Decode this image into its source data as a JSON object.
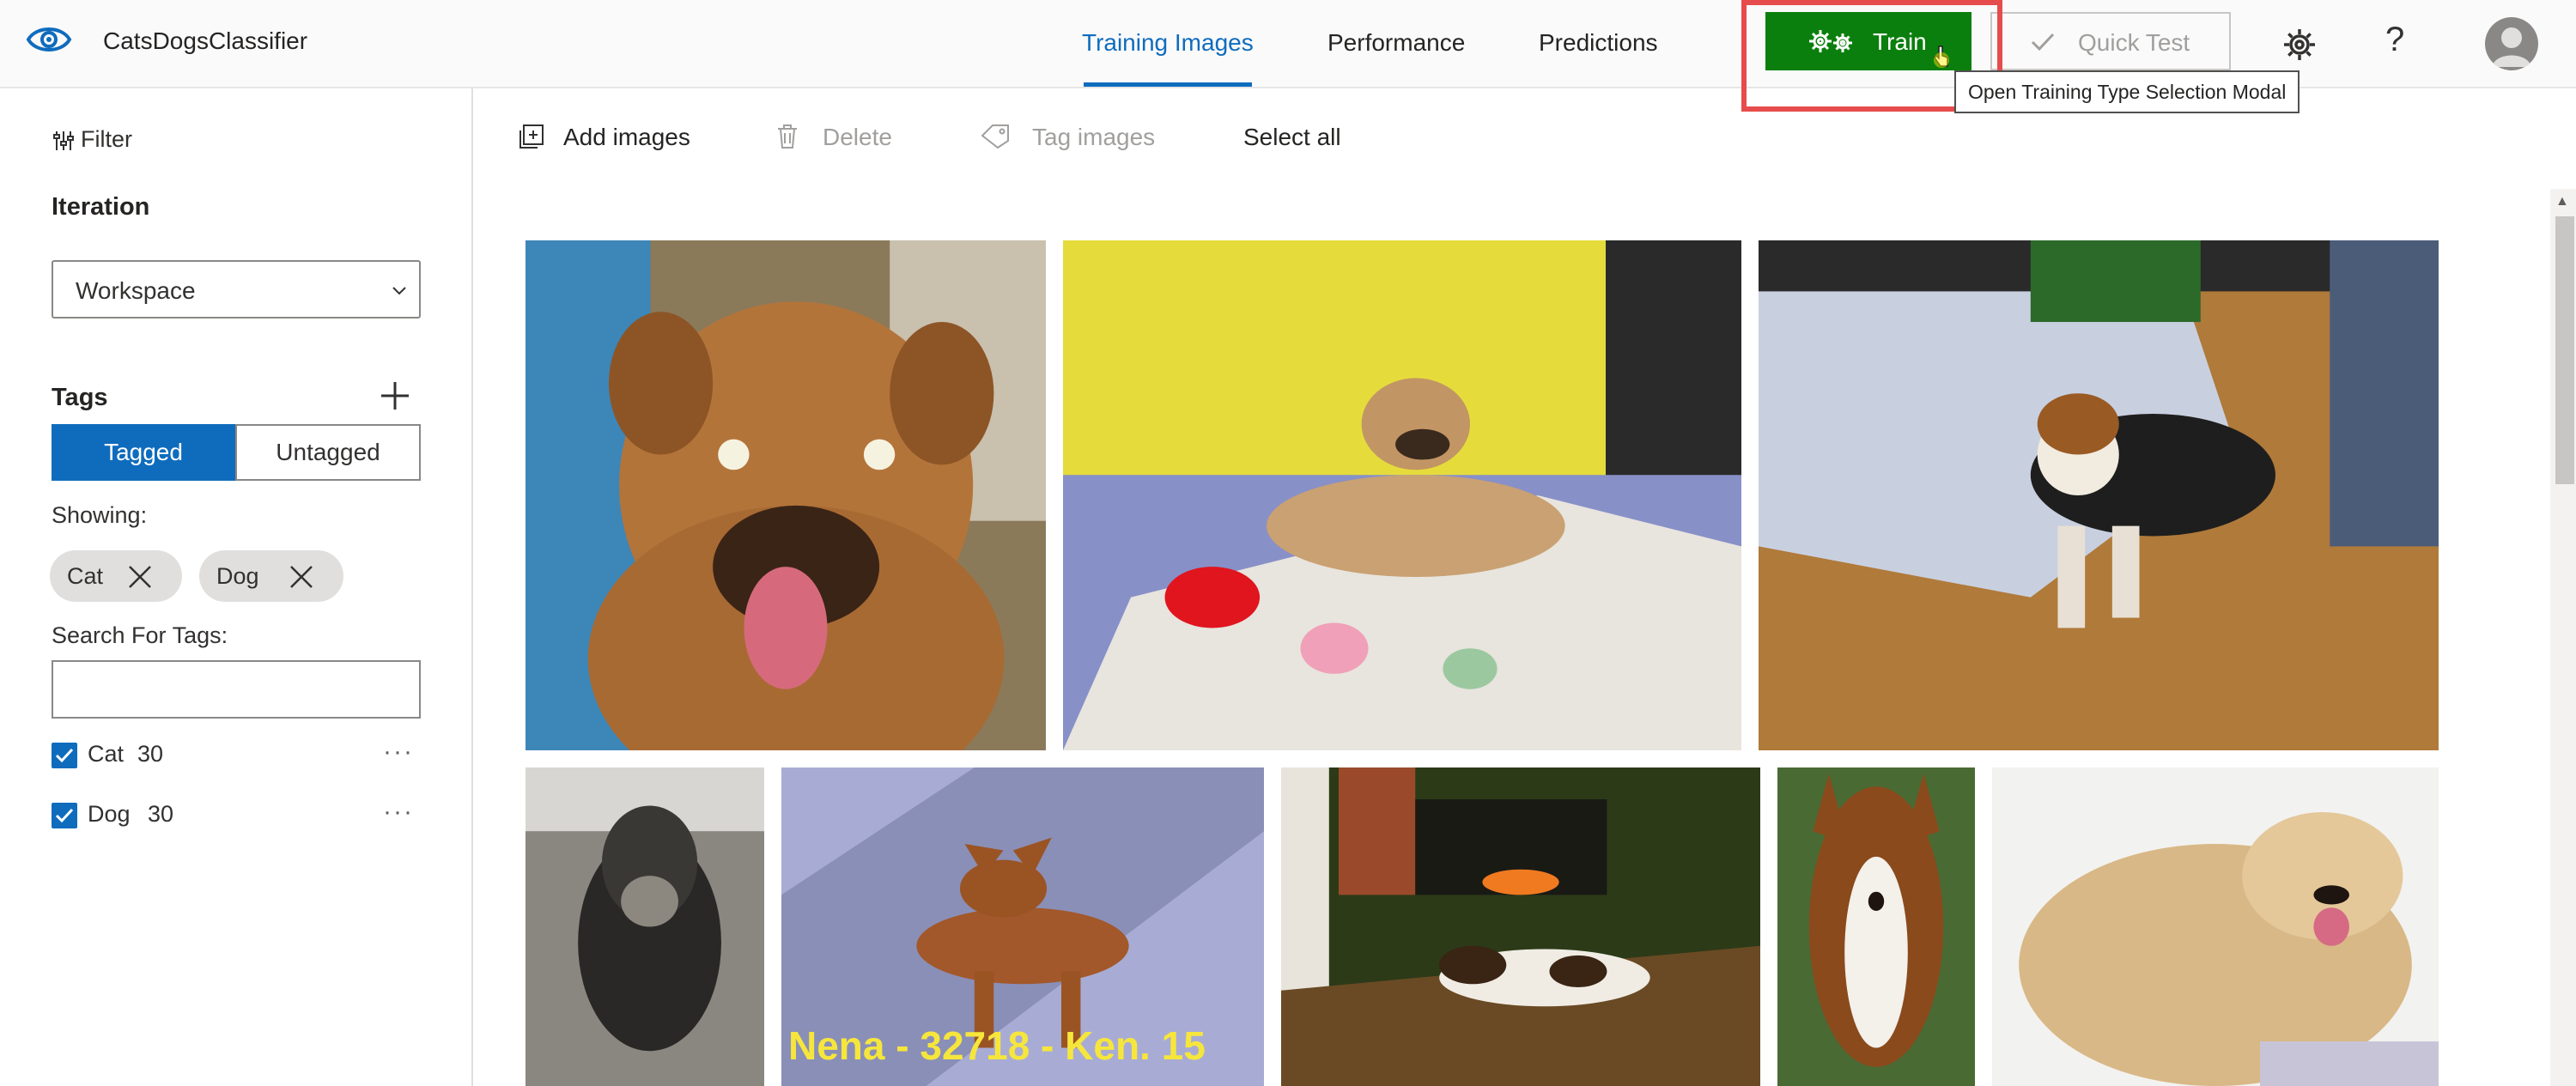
{
  "app": {
    "name": "CatsDogsClassifier"
  },
  "nav": {
    "tabs": [
      {
        "label": "Training Images",
        "active": true
      },
      {
        "label": "Performance",
        "active": false
      },
      {
        "label": "Predictions",
        "active": false
      }
    ]
  },
  "actions": {
    "train_label": "Train",
    "quick_test_label": "Quick Test",
    "tooltip": "Open Training Type Selection Modal"
  },
  "sidebar": {
    "filter_label": "Filter",
    "iteration_title": "Iteration",
    "iteration_value": "Workspace",
    "tags_title": "Tags",
    "toggle": {
      "tagged": "Tagged",
      "untagged": "Untagged",
      "selected": "Tagged"
    },
    "showing_label": "Showing:",
    "chips": [
      {
        "label": "Cat"
      },
      {
        "label": "Dog"
      }
    ],
    "search_label": "Search For Tags:",
    "search_value": "",
    "tags": [
      {
        "name": "Cat",
        "count": "30",
        "checked": true
      },
      {
        "name": "Dog",
        "count": "30",
        "checked": true
      }
    ],
    "more_label": "···"
  },
  "toolbar": {
    "add_images": "Add images",
    "delete": "Delete",
    "tag_images": "Tag images",
    "select_all": "Select all"
  },
  "images": [
    {
      "subject": "brown boxer-mix dog portrait",
      "caption": ""
    },
    {
      "subject": "tan puppy lying on blanket",
      "caption": ""
    },
    {
      "subject": "tricolor dog on carpet",
      "caption": ""
    },
    {
      "subject": "dark schnauzer-mix dog",
      "caption": ""
    },
    {
      "subject": "red dog on sidewalk",
      "caption": "Nena - 32718 - Ken. 15"
    },
    {
      "subject": "dog lying by fireplace",
      "caption": ""
    },
    {
      "subject": "sheltie dog",
      "caption": ""
    },
    {
      "subject": "fluffy cream terrier",
      "caption": ""
    }
  ],
  "colors": {
    "accent": "#0f6cbd",
    "train_green": "#0b7f0d",
    "highlight_red": "#e74c4c"
  }
}
